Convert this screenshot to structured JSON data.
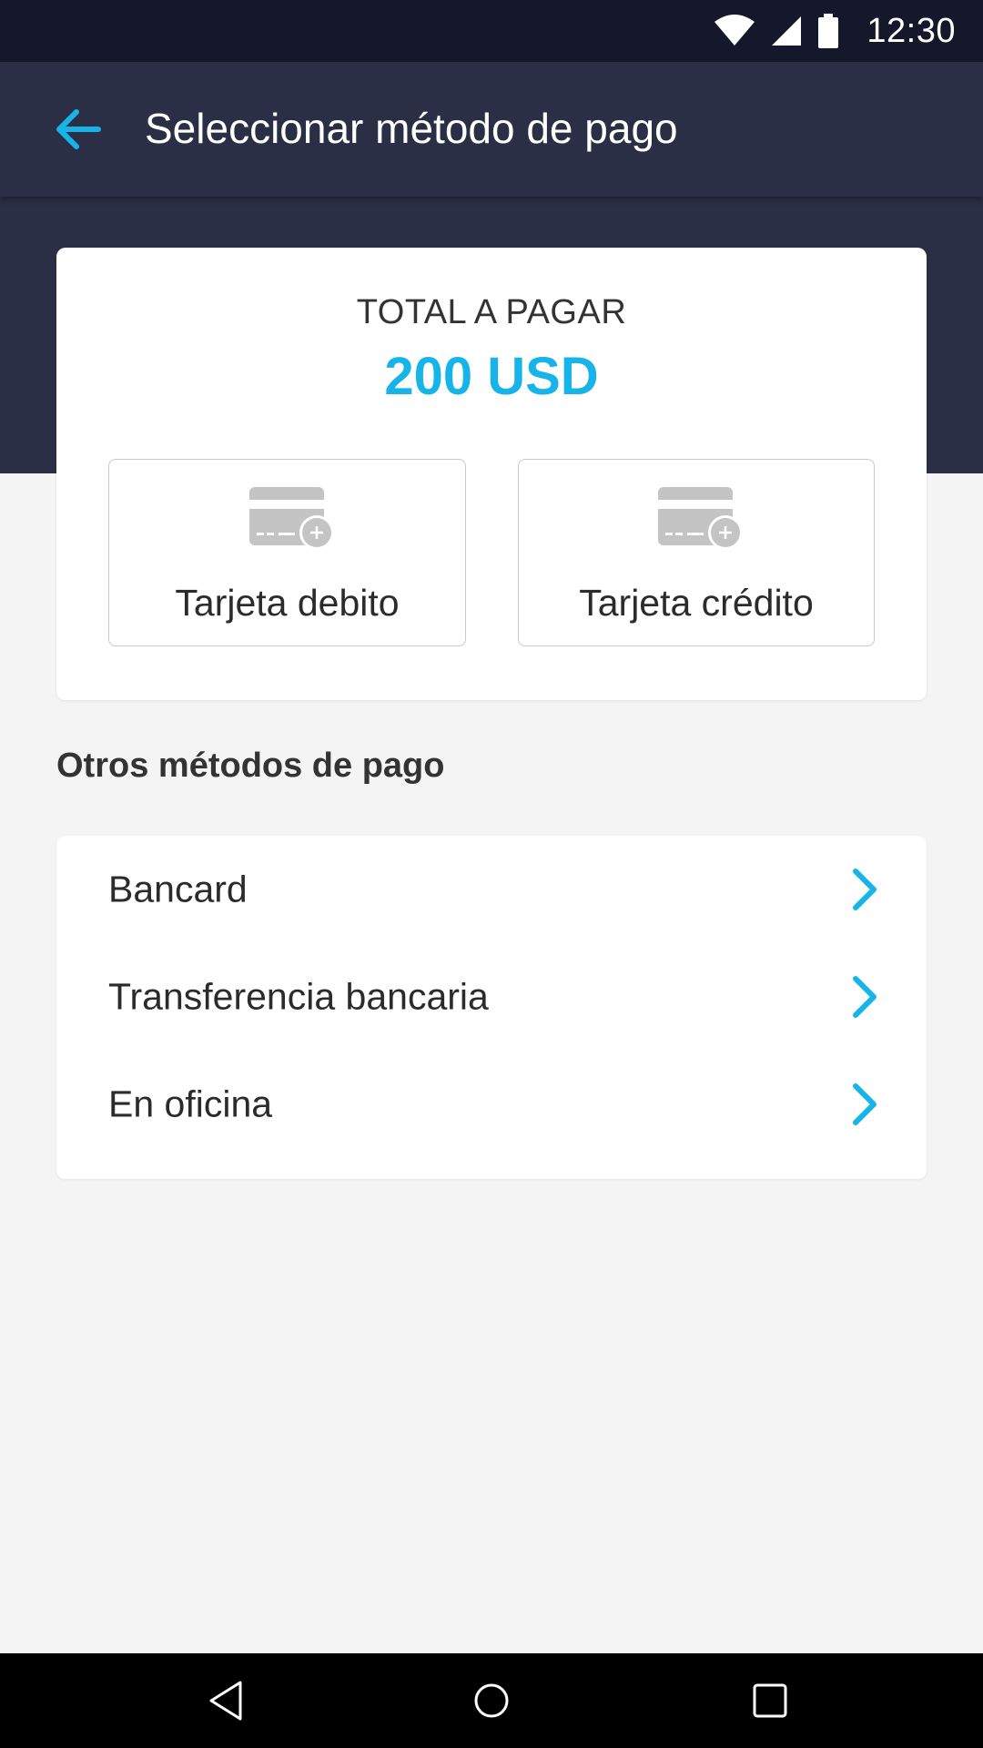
{
  "status_bar": {
    "time": "12:30",
    "icons": [
      "wifi-icon",
      "cell-signal-icon",
      "battery-icon"
    ]
  },
  "app_bar": {
    "back_icon": "arrow-left-icon",
    "title": "Seleccionar método de pago"
  },
  "total": {
    "label": "TOTAL A PAGAR",
    "amount": "200 USD"
  },
  "card_options": [
    {
      "label": "Tarjeta debito",
      "icon": "add-card-icon"
    },
    {
      "label": "Tarjeta crédito",
      "icon": "add-card-icon"
    }
  ],
  "other_methods": {
    "title": "Otros métodos de pago",
    "items": [
      {
        "label": "Bancard",
        "icon": "chevron-right-icon"
      },
      {
        "label": "Transferencia bancaria",
        "icon": "chevron-right-icon"
      },
      {
        "label": "En oficina",
        "icon": "chevron-right-icon"
      }
    ]
  },
  "nav_bar": {
    "buttons": [
      "nav-back-icon",
      "nav-home-icon",
      "nav-recent-icon"
    ]
  },
  "colors": {
    "status_bar": "#14182a",
    "header": "#2b2f45",
    "accent": "#17b4ea",
    "background": "#f4f4f4",
    "card": "#ffffff",
    "icon_grey": "#c4c4c4"
  }
}
